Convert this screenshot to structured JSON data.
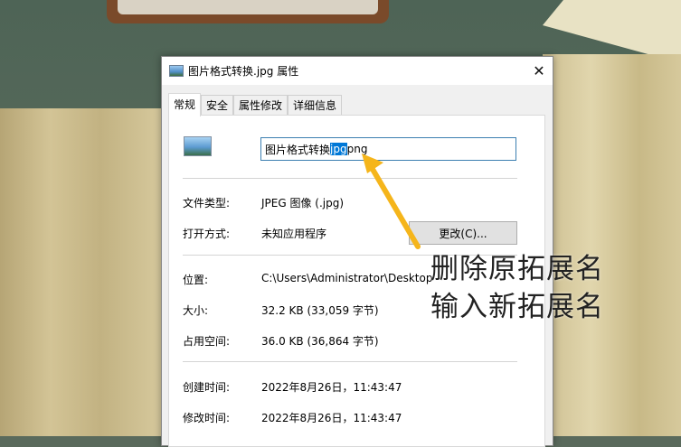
{
  "window": {
    "title": "图片格式转换.jpg 属性",
    "close_glyph": "✕"
  },
  "tabs": [
    {
      "label": "常规",
      "active": true
    },
    {
      "label": "安全",
      "active": false
    },
    {
      "label": "属性修改",
      "active": false
    },
    {
      "label": "详细信息",
      "active": false
    }
  ],
  "filename": {
    "prefix": "图片格式转换",
    "selected": "jpg",
    "suffix": "png"
  },
  "properties": {
    "file_type_label": "文件类型:",
    "file_type_value": "JPEG 图像 (.jpg)",
    "opens_with_label": "打开方式:",
    "opens_with_value": "未知应用程序",
    "change_button": "更改(C)...",
    "location_label": "位置:",
    "location_value": "C:\\Users\\Administrator\\Desktop",
    "size_label": "大小:",
    "size_value": "32.2 KB (33,059 字节)",
    "size_on_disk_label": "占用空间:",
    "size_on_disk_value": "36.0 KB (36,864 字节)",
    "created_label": "创建时间:",
    "created_value": "2022年8月26日，11:43:47",
    "modified_label": "修改时间:",
    "modified_value": "2022年8月26日，11:43:47"
  },
  "annotation": {
    "line1": "删除原拓展名",
    "line2": "输入新拓展名",
    "arrow_color": "#f5b51b"
  },
  "icons": {
    "title_icon": "image-file-icon",
    "file_icon": "image-file-icon"
  }
}
